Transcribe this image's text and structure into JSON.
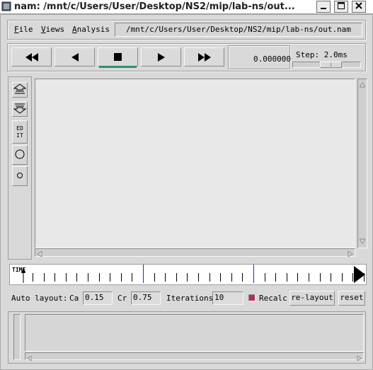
{
  "window": {
    "title": "nam: /mnt/c/Users/User/Desktop/NS2/mip/lab-ns/out...",
    "controls": [
      "minimize-icon",
      "maximize-icon",
      "close-icon"
    ]
  },
  "menu": {
    "file_first": "F",
    "file_rest": "ile",
    "views_first": "V",
    "views_rest": "iews",
    "analysis_first": "A",
    "analysis_rest": "nalysis"
  },
  "file_path": "/mnt/c/Users/User/Desktop/NS2/mip/lab-ns/out.nam",
  "playback": {
    "buttons": [
      "rewind-icon",
      "step-back-icon",
      "stop-icon",
      "play-icon",
      "fast-forward-icon"
    ],
    "active_button": "stop",
    "active_color": "#2f8f6a",
    "time": "0.000000",
    "step_label": "Step: 2.0ms"
  },
  "editor_tools": [
    "zoom-in-icon",
    "zoom-out-icon",
    "edit-icon",
    "node-large-icon",
    "node-small-icon"
  ],
  "edit_button": {
    "line1": "ED",
    "line2": "IT"
  },
  "timeline": {
    "label": "TIME"
  },
  "layout": {
    "auto_label": "Auto layout:",
    "ca_label": "Ca",
    "ca_value": "0.15",
    "cr_label": "Cr",
    "cr_value": "0.75",
    "iterations_label": "Iterations",
    "iterations_value": "10",
    "recalc_label": "Recalc",
    "recalc_checked": true,
    "relayout_button": "re-layout",
    "reset_button": "reset"
  }
}
